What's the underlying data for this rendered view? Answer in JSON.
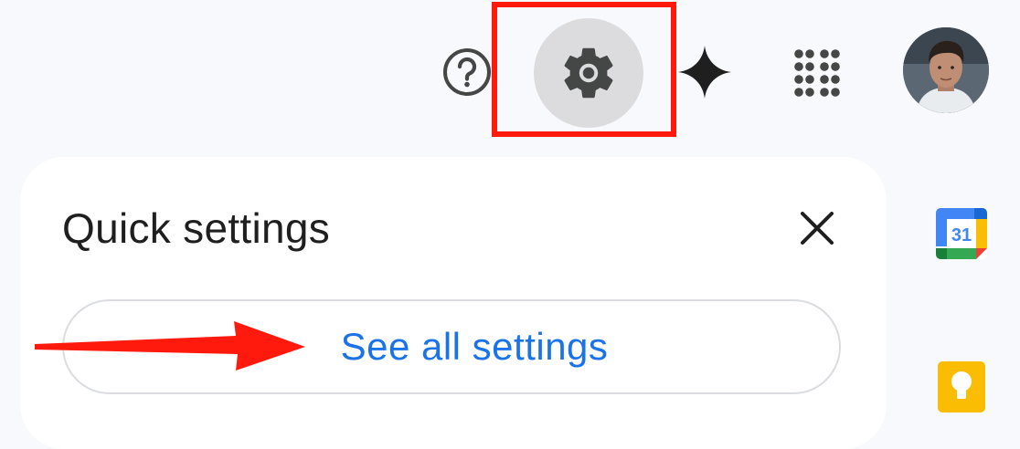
{
  "header": {
    "help_icon": "help-circle-icon",
    "settings_icon": "gear-icon",
    "gemini_icon": "gemini-sparkle-icon",
    "apps_icon": "apps-grid-icon",
    "avatar": "account-avatar"
  },
  "quick_settings": {
    "title": "Quick settings",
    "close_icon": "close-icon",
    "see_all_label": "See all settings"
  },
  "side_panel": {
    "calendar_day": "31",
    "calendar_icon": "google-calendar-icon",
    "keep_icon": "google-keep-icon"
  },
  "annotations": {
    "highlight_color": "#ff1a0d",
    "arrow_color": "#ff1a0d"
  },
  "colors": {
    "link_blue": "#1a73e8",
    "settings_hover_bg": "#dcdcdf",
    "page_bg": "#f8f9fd"
  }
}
